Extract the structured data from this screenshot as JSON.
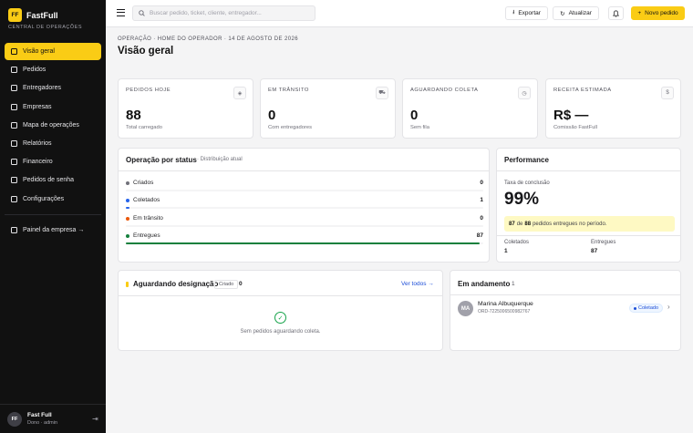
{
  "app": {
    "logo": "FF",
    "name": "FastFull",
    "subtitle": "CENTRAL DE OPERAÇÕES"
  },
  "sidebar": {
    "items": [
      {
        "label": "Visão geral",
        "icon": "grid-icon",
        "active": true
      },
      {
        "label": "Pedidos",
        "icon": "box-icon"
      },
      {
        "label": "Entregadores",
        "icon": "users-icon"
      },
      {
        "label": "Empresas",
        "icon": "building-icon"
      },
      {
        "label": "Mapa de operações",
        "icon": "map-icon"
      },
      {
        "label": "Relatórios",
        "icon": "chart-icon"
      },
      {
        "label": "Financeiro",
        "icon": "wallet-icon"
      },
      {
        "label": "Pedidos de senha",
        "icon": "key-icon"
      },
      {
        "label": "Configurações",
        "icon": "gear-icon"
      }
    ],
    "company_panel": "Painel da empresa →"
  },
  "user": {
    "initials": "FF",
    "name": "Fast Full",
    "role": "Dono · admin"
  },
  "topbar": {
    "search_placeholder": "Buscar pedido, ticket, cliente, entregador...",
    "export_label": "Exportar",
    "update_label": "Atualizar",
    "new_order_label": "Novo pedido"
  },
  "header": {
    "breadcrumb": "OPERAÇÃO · HOME DO OPERADOR · 14 DE AGOSTO DE 2026",
    "title": "Visão geral"
  },
  "kpis": [
    {
      "label": "PEDIDOS HOJE",
      "value": "88",
      "sub": "Total carregado",
      "icon": "◈"
    },
    {
      "label": "EM TRÂNSITO",
      "value": "0",
      "sub": "Com entregadores",
      "icon": "⛟"
    },
    {
      "label": "AGUARDANDO COLETA",
      "value": "0",
      "sub": "Sem fila",
      "icon": "◷"
    },
    {
      "label": "RECEITA ESTIMADA",
      "value": "R$ —",
      "sub": "Comissão FastFull",
      "icon": "$"
    }
  ],
  "status": {
    "title": "Operação por status",
    "subtitle": "· Distribuição atual",
    "rows": [
      {
        "label": "Criados",
        "count": "0",
        "color": "#71717a",
        "fraction": 0
      },
      {
        "label": "Coletados",
        "count": "1",
        "color": "#2563eb",
        "fraction": 0.011
      },
      {
        "label": "Em trânsito",
        "count": "0",
        "color": "#ea580c",
        "fraction": 0
      },
      {
        "label": "Entregues",
        "count": "87",
        "color": "#15803d",
        "fraction": 0.989
      }
    ]
  },
  "performance": {
    "title": "Performance",
    "rate_label": "Taxa de conclusão",
    "rate_value": "99%",
    "note_delivered": "87",
    "note_of": "de",
    "note_total": "88",
    "note_rest": "pedidos entregues no período.",
    "collected_label": "Coletados",
    "collected_value": "1",
    "delivered_label": "Entregues",
    "delivered_value": "87"
  },
  "waiting": {
    "title": "Aguardando designação",
    "tag": "Criado",
    "count": "0",
    "see_all": "Ver todos →",
    "empty_text": "Sem pedidos aguardando coleta."
  },
  "in_progress": {
    "title": "Em andamento",
    "count": "1",
    "items": [
      {
        "initials": "MA",
        "name": "Marina Albuquerque",
        "order_id": "ORD-7225006500982767",
        "status": "Coletado"
      }
    ]
  }
}
